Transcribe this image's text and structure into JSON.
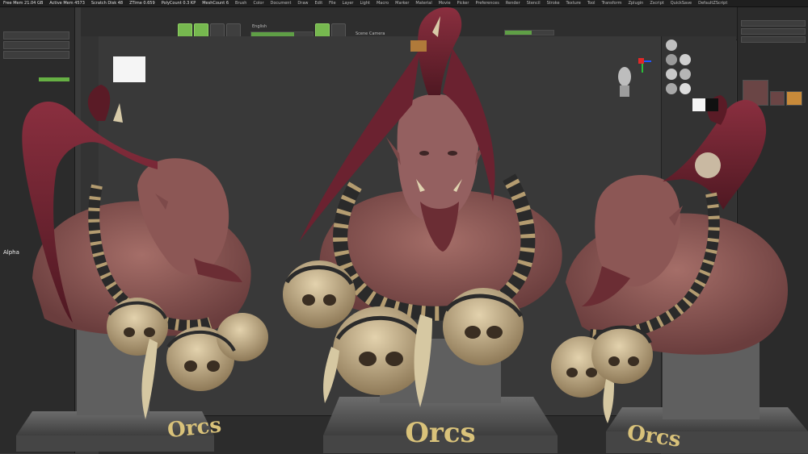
{
  "menubar": {
    "items": [
      "Brush",
      "Color",
      "Document",
      "Draw",
      "Edit",
      "File",
      "Layer",
      "Light",
      "Macro",
      "Marker",
      "Material",
      "Movie",
      "Picker",
      "Preferences",
      "Render",
      "Stencil",
      "Stroke",
      "Texture",
      "Tool",
      "Transform",
      "Zplugin",
      "Zscript"
    ],
    "stats": [
      "Free Mem 21.04 GB",
      "Active Mem 4573",
      "Scratch Disk 48",
      "ZTime 0.659",
      "PolyCount 0.3 KP",
      "MeshCount 6"
    ],
    "quicksave": "QuickSave",
    "default_script": "DefaultZScript"
  },
  "toolbar": {
    "font_label": "English",
    "camera_label": "Scene Camera"
  },
  "left_panel": {
    "items": [
      "Alpha"
    ]
  },
  "artwork": {
    "label_left": "Orcs",
    "label_center": "Orcs",
    "label_right": "Orcs"
  },
  "colors": {
    "ui_dark": "#2b2b2b",
    "ui_accent_green": "#66b044",
    "skin": "#8e5a5a",
    "hair": "#6b2230",
    "bone": "#c9b48c",
    "pedestal": "#5c5c5c",
    "label_gold": "#d9c27a"
  }
}
